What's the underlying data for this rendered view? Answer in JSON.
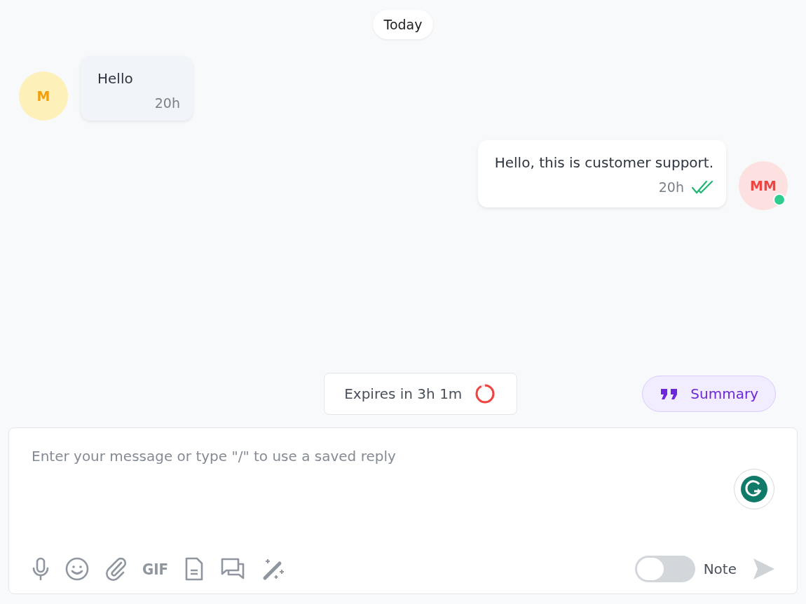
{
  "date_divider": "Today",
  "messages": [
    {
      "kind": "incoming",
      "avatar": "M",
      "text": "Hello",
      "time": "20h"
    },
    {
      "kind": "outgoing",
      "avatar": "MM",
      "text": "Hello, this is customer support.",
      "time": "20h",
      "read": true,
      "online": true
    }
  ],
  "expiry": {
    "label": "Expires in 3h 1m",
    "level": 0.92
  },
  "summary_button": "Summary",
  "composer": {
    "placeholder": "Enter your message or type \"/\" to use a saved reply",
    "tools": [
      {
        "kind": "mic"
      },
      {
        "kind": "emoji"
      },
      {
        "kind": "attach"
      },
      {
        "kind": "gif",
        "label": "GIF"
      },
      {
        "kind": "document"
      },
      {
        "kind": "chats"
      },
      {
        "kind": "magic"
      }
    ],
    "note_toggle": {
      "label": "Note",
      "on": false
    }
  }
}
